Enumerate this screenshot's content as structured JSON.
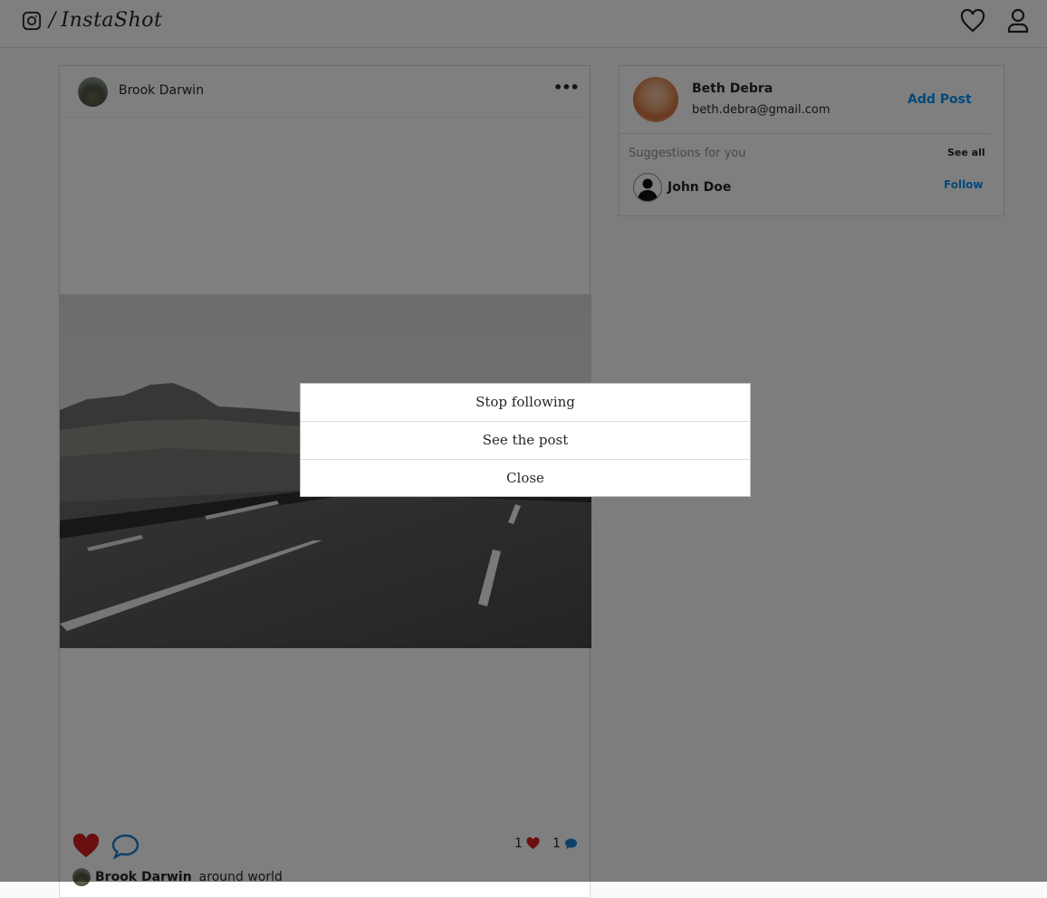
{
  "header": {
    "brand_separator": "/",
    "brand_name": "InstaShot",
    "icons": [
      "instagram-icon",
      "heart-icon",
      "user-icon"
    ]
  },
  "post": {
    "username": "Brook Darwin",
    "more_label": "•••",
    "likes_count": "1",
    "comments_count": "1",
    "caption_user": "Brook Darwin",
    "caption_text": "around world"
  },
  "sidebar": {
    "user_name": "Beth Debra",
    "user_email": "beth.debra@gmail.com",
    "add_post_label": "Add Post",
    "suggestions_title": "Suggestions for you",
    "see_all_label": "See all",
    "suggestions": [
      {
        "name": "John Doe",
        "action": "Follow"
      }
    ]
  },
  "modal": {
    "items": [
      "Stop following",
      "See the post",
      "Close"
    ]
  },
  "colors": {
    "accent": "#0095f6",
    "like_red": "#d21f1f",
    "comment_blue": "#1d7fd0",
    "overlay": "rgba(0,0,0,0.5)"
  }
}
